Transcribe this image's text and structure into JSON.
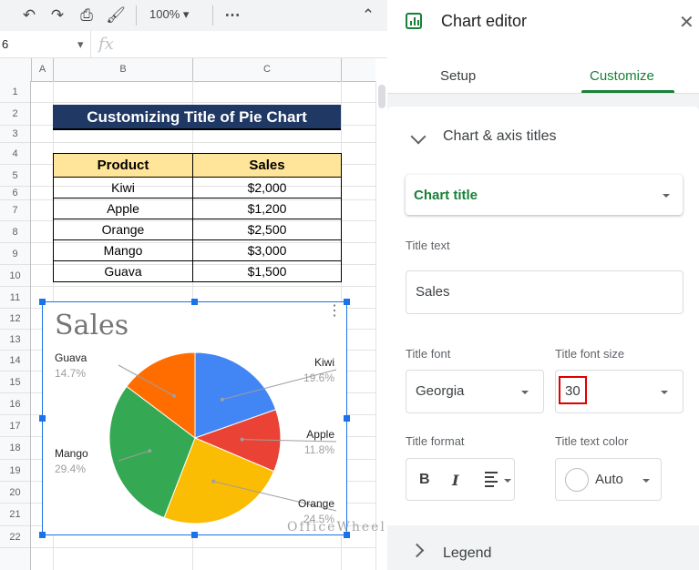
{
  "toolbar": {
    "icons": [
      "undo-icon",
      "redo-icon",
      "print-icon",
      "paint-format-icon",
      "more-icon",
      "collapse-icon"
    ],
    "zoom": "100%"
  },
  "formula_bar": {
    "name_box": "6",
    "fx": "fx"
  },
  "columns": [
    "A",
    "B",
    "C"
  ],
  "rows": [
    "1",
    "2",
    "3",
    "4",
    "5",
    "6",
    "7",
    "8",
    "9",
    "10",
    "11",
    "12",
    "13",
    "14",
    "15",
    "16",
    "17",
    "18",
    "19",
    "20",
    "21",
    "22"
  ],
  "sheet": {
    "title": "Customizing Title of Pie Chart",
    "headers": [
      "Product",
      "Sales"
    ],
    "data": [
      [
        "Kiwi",
        "$2,000"
      ],
      [
        "Apple",
        "$1,200"
      ],
      [
        "Orange",
        "$2,500"
      ],
      [
        "Mango",
        "$3,000"
      ],
      [
        "Guava",
        "$1,500"
      ]
    ]
  },
  "chart_data": {
    "type": "pie",
    "title": "Sales",
    "title_font": "Georgia",
    "title_font_size": 30,
    "categories": [
      "Kiwi",
      "Apple",
      "Orange",
      "Mango",
      "Guava"
    ],
    "values": [
      2000,
      1200,
      2500,
      3000,
      1500
    ],
    "percent_labels": [
      "19.6%",
      "11.8%",
      "24.5%",
      "29.4%",
      "14.7%"
    ],
    "colors": [
      "#4285f4",
      "#ea4335",
      "#fbbc04",
      "#34a853",
      "#ff6d01"
    ],
    "legend": "labeled"
  },
  "editor": {
    "title": "Chart editor",
    "tabs": [
      "Setup",
      "Customize"
    ],
    "active_tab": "Customize",
    "section": "Chart & axis titles",
    "title_select": "Chart title",
    "title_text_label": "Title text",
    "title_text_value": "Sales",
    "title_font_label": "Title font",
    "title_font_value": "Georgia",
    "title_font_size_label": "Title font size",
    "title_font_size_value": "30",
    "title_format_label": "Title format",
    "format_bold": "B",
    "format_italic": "I",
    "title_text_color_label": "Title text color",
    "title_text_color_value": "Auto",
    "next_section": "Legend",
    "accent_color": "#188038"
  },
  "watermark": "OfficeWheel"
}
